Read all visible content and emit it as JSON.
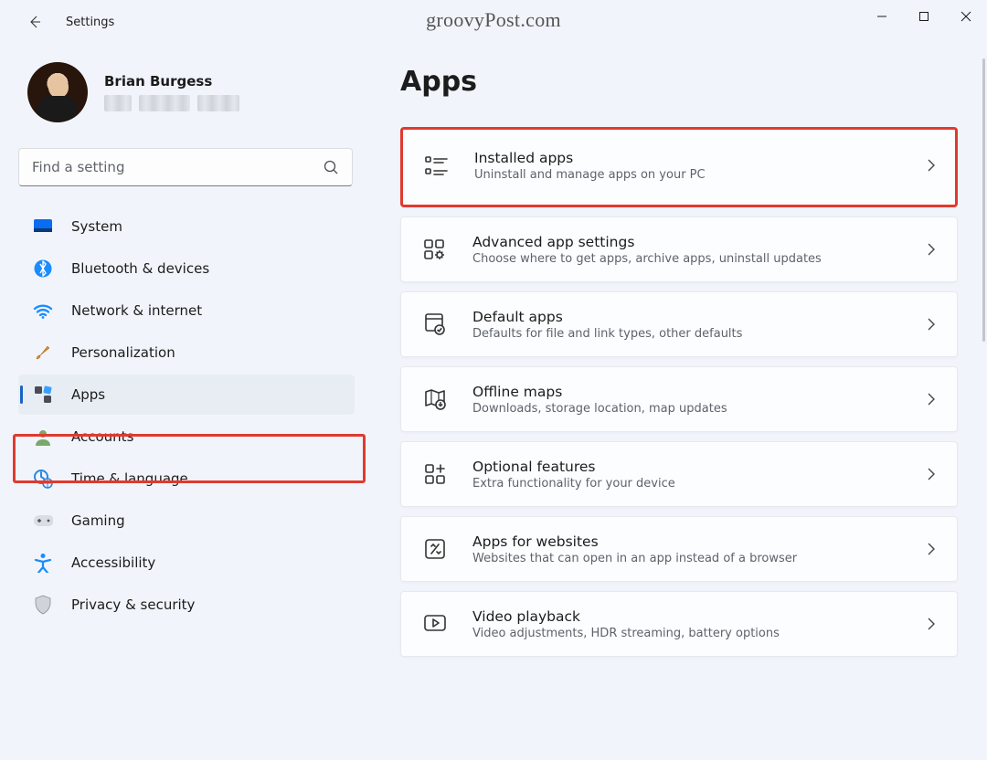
{
  "window": {
    "title": "Settings",
    "watermark": "groovyPost.com"
  },
  "profile": {
    "name": "Brian Burgess"
  },
  "search": {
    "placeholder": "Find a setting"
  },
  "nav": {
    "items": [
      {
        "id": "system",
        "label": "System"
      },
      {
        "id": "bluetooth",
        "label": "Bluetooth & devices"
      },
      {
        "id": "network",
        "label": "Network & internet"
      },
      {
        "id": "personalization",
        "label": "Personalization"
      },
      {
        "id": "apps",
        "label": "Apps",
        "selected": true
      },
      {
        "id": "accounts",
        "label": "Accounts"
      },
      {
        "id": "time-language",
        "label": "Time & language"
      },
      {
        "id": "gaming",
        "label": "Gaming"
      },
      {
        "id": "accessibility",
        "label": "Accessibility"
      },
      {
        "id": "privacy",
        "label": "Privacy & security"
      }
    ]
  },
  "page": {
    "title": "Apps",
    "cards": [
      {
        "id": "installed-apps",
        "title": "Installed apps",
        "subtitle": "Uninstall and manage apps on your PC",
        "highlighted": true
      },
      {
        "id": "advanced-app",
        "title": "Advanced app settings",
        "subtitle": "Choose where to get apps, archive apps, uninstall updates"
      },
      {
        "id": "default-apps",
        "title": "Default apps",
        "subtitle": "Defaults for file and link types, other defaults"
      },
      {
        "id": "offline-maps",
        "title": "Offline maps",
        "subtitle": "Downloads, storage location, map updates"
      },
      {
        "id": "optional-features",
        "title": "Optional features",
        "subtitle": "Extra functionality for your device"
      },
      {
        "id": "apps-websites",
        "title": "Apps for websites",
        "subtitle": "Websites that can open in an app instead of a browser"
      },
      {
        "id": "video-playback",
        "title": "Video playback",
        "subtitle": "Video adjustments, HDR streaming, battery options"
      }
    ]
  }
}
